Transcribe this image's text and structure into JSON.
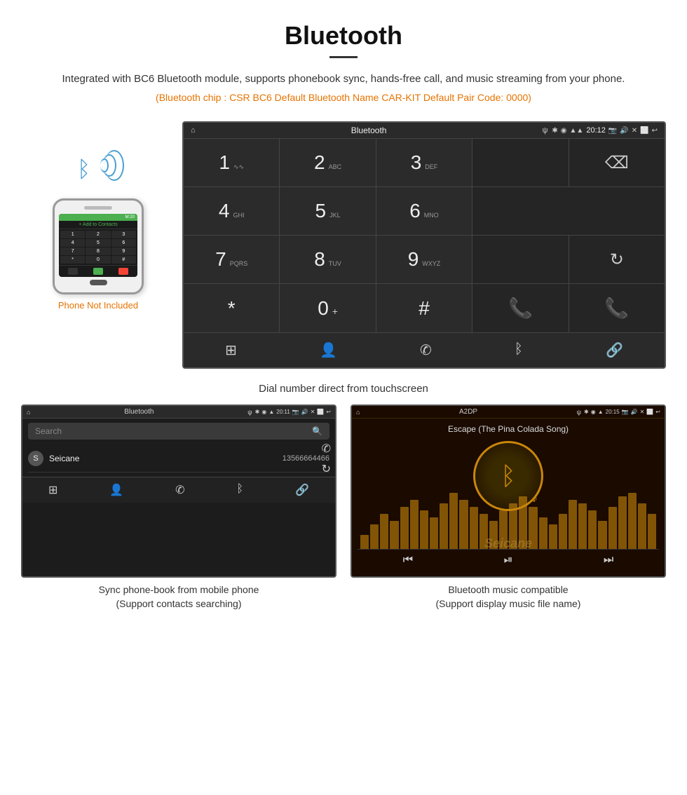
{
  "header": {
    "title": "Bluetooth",
    "description": "Integrated with BC6 Bluetooth module, supports phonebook sync, hands-free call, and music streaming from your phone.",
    "specs": "(Bluetooth chip : CSR BC6   Default Bluetooth Name CAR-KIT    Default Pair Code: 0000)"
  },
  "phone_label": "Phone Not Included",
  "dial_screen": {
    "status_bar": {
      "home_icon": "⌂",
      "title": "Bluetooth",
      "usb_icon": "ψ",
      "bt_icon": "✱",
      "location_icon": "◉",
      "signal_icon": "▲",
      "time": "20:12",
      "camera_icon": "📷",
      "volume_icon": "🔊",
      "close_icon": "✕",
      "screen_icon": "⬜",
      "back_icon": "↩"
    },
    "keys": [
      {
        "number": "1",
        "letters": "∿"
      },
      {
        "number": "2",
        "letters": "ABC"
      },
      {
        "number": "3",
        "letters": "DEF"
      },
      {
        "action": "backspace"
      },
      {
        "number": "4",
        "letters": "GHI"
      },
      {
        "number": "5",
        "letters": "JKL"
      },
      {
        "number": "6",
        "letters": "MNO"
      },
      {
        "action": "empty"
      },
      {
        "number": "7",
        "letters": "PQRS"
      },
      {
        "number": "8",
        "letters": "TUV"
      },
      {
        "number": "9",
        "letters": "WXYZ"
      },
      {
        "action": "refresh"
      },
      {
        "number": "*",
        "letters": ""
      },
      {
        "number": "0",
        "letters": "+"
      },
      {
        "number": "#",
        "letters": ""
      },
      {
        "action": "call_green"
      },
      {
        "action": "empty2"
      },
      {
        "action": "call_red"
      }
    ],
    "toolbar": {
      "icons": [
        "⊞",
        "👤",
        "✆",
        "ᛒ",
        "🔗"
      ]
    }
  },
  "dial_caption": "Dial number direct from touchscreen",
  "phonebook_screen": {
    "status_bar": {
      "title": "Bluetooth",
      "time": "20:11"
    },
    "search_placeholder": "Search",
    "contact": {
      "letter": "S",
      "name": "Seicane",
      "number": "13566664466"
    },
    "toolbar_icons": [
      "⊞",
      "👤",
      "✆",
      "ᛒ",
      "🔗"
    ],
    "sidebar_icons": [
      "✆",
      "↻"
    ]
  },
  "phonebook_caption": {
    "line1": "Sync phone-book from mobile phone",
    "line2": "(Support contacts searching)"
  },
  "music_screen": {
    "status_bar": {
      "title": "A2DP",
      "time": "20:15"
    },
    "song_title": "Escape (The Pina Colada Song)",
    "eq_bars": [
      20,
      35,
      50,
      40,
      60,
      70,
      55,
      45,
      65,
      80,
      70,
      60,
      50,
      40,
      55,
      65,
      75,
      60,
      45,
      35,
      50,
      70,
      65,
      55,
      40,
      60,
      75,
      80,
      65,
      50
    ],
    "controls": [
      "⏮",
      "⏯",
      "⏭"
    ],
    "watermark": "Seicane"
  },
  "music_caption": {
    "line1": "Bluetooth music compatible",
    "line2": "(Support display music file name)"
  }
}
